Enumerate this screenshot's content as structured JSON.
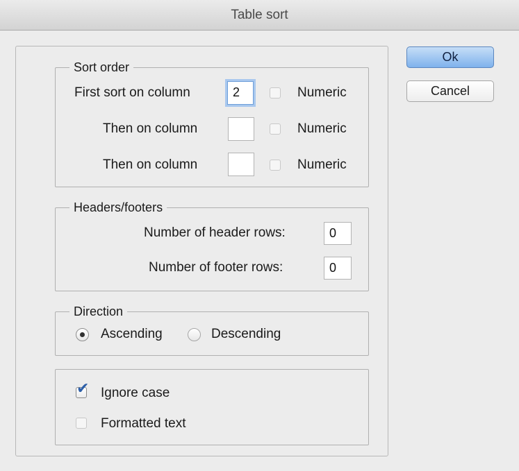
{
  "window": {
    "title": "Table sort"
  },
  "buttons": {
    "ok": "Ok",
    "cancel": "Cancel"
  },
  "sort_order": {
    "legend": "Sort order",
    "rows": [
      {
        "label": "First sort on column",
        "value": "2",
        "numeric_label": "Numeric",
        "numeric_checked": false
      },
      {
        "label": "Then on column",
        "value": "",
        "numeric_label": "Numeric",
        "numeric_checked": false
      },
      {
        "label": "Then on column",
        "value": "",
        "numeric_label": "Numeric",
        "numeric_checked": false
      }
    ]
  },
  "headers_footers": {
    "legend": "Headers/footers",
    "header_rows_label": "Number of header rows:",
    "header_rows_value": "0",
    "footer_rows_label": "Number of footer rows:",
    "footer_rows_value": "0"
  },
  "direction": {
    "legend": "Direction",
    "options": [
      "Ascending",
      "Descending"
    ],
    "selected": "Ascending"
  },
  "options": {
    "ignore_case_label": "Ignore case",
    "ignore_case_checked": true,
    "formatted_text_label": "Formatted text",
    "formatted_text_checked": false
  },
  "colors": {
    "accent": "#7fb2ec",
    "focus": "#a9c8ee",
    "check": "#2d5fa8"
  }
}
